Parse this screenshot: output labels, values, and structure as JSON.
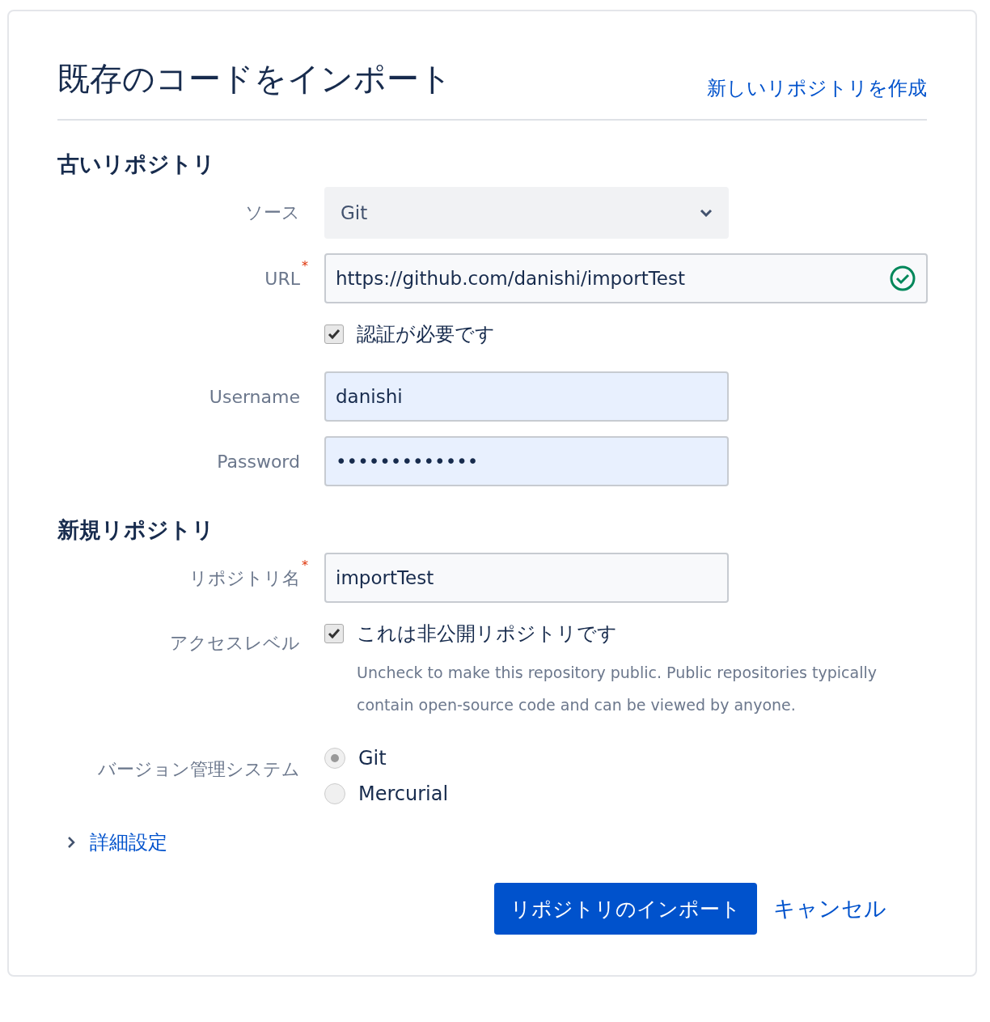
{
  "header": {
    "title": "既存のコードをインポート",
    "link": "新しいリポジトリを作成"
  },
  "sections": [
    {
      "heading": "古いリポジトリ",
      "rows": [
        {
          "kind": "select",
          "label": "ソース",
          "value": "Git"
        },
        {
          "kind": "input",
          "label": "URL",
          "required_mark": "*",
          "value": "https://github.com/danishi/importTest",
          "valid": true,
          "autofilled": false,
          "wide": true
        },
        {
          "kind": "checkbox",
          "label": "",
          "text": "認証が必要です",
          "checked": true
        },
        {
          "kind": "input",
          "label": "Username",
          "value": "danishi",
          "valid": false,
          "autofilled": true,
          "wide": false
        },
        {
          "kind": "input",
          "label": "Password",
          "value": "•••••••••••••",
          "valid": false,
          "autofilled": true,
          "wide": false
        }
      ]
    },
    {
      "heading": "新規リポジトリ",
      "rows": [
        {
          "kind": "input",
          "label": "リポジトリ名",
          "required_mark": "*",
          "value": "importTest",
          "valid": false,
          "autofilled": false,
          "wide": false
        },
        {
          "kind": "checkbox",
          "label": "アクセスレベル",
          "text": "これは非公開リポジトリです",
          "checked": true,
          "hint": "Uncheck to make this repository public. Public repositories typically contain open-source code and can be viewed by anyone."
        },
        {
          "kind": "radio",
          "label": "バージョン管理システム",
          "options": [
            {
              "text": "Git",
              "selected": true
            },
            {
              "text": "Mercurial",
              "selected": false
            }
          ]
        }
      ]
    }
  ],
  "advanced": {
    "label": "詳細設定",
    "expanded": false
  },
  "buttons": {
    "submit": "リポジトリのインポート",
    "cancel": "キャンセル"
  }
}
